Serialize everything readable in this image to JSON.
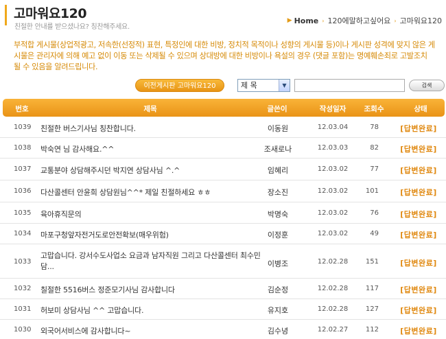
{
  "header": {
    "title": "고마워요120",
    "subtitle": "친절한 안내를 받으셨나요? 칭찬해주세요."
  },
  "breadcrumb": {
    "home": "Home",
    "items": [
      "120에말하고싶어요",
      "고마워요120"
    ]
  },
  "notice": "부적합 게시물(상업적광고, 저속한(선정적) 표현, 특정인에 대한 비방, 정치적 목적이나 성향의 게시물 등)이나 게시판 성격에 맞지 않은 게시물은 관리자에 의해 예고 없이 이동 또는 삭제될 수 있으며 상대방에 대한 비방이나 욕설의 경우 (댓글 포함)는 명예훼손죄로 고발조치 될 수 있음을 알려드립니다.",
  "search": {
    "prev_board_label": "이전게시판 고마워요120",
    "select_value": "제 목",
    "input_value": "",
    "button_label": "검색"
  },
  "table": {
    "columns": [
      "번호",
      "제목",
      "글쓴이",
      "작성일자",
      "조회수",
      "상태"
    ],
    "rows": [
      {
        "num": "1039",
        "title": "친절한 버스기사님 칭찬합니다.",
        "author": "이동원",
        "date": "12.03.04",
        "views": "78",
        "status": "[답변완료]"
      },
      {
        "num": "1038",
        "title": "박숙연 님 감사해요.^^",
        "author": "조새로나",
        "date": "12.03.03",
        "views": "82",
        "status": "[답변완료]"
      },
      {
        "num": "1037",
        "title": "교통분야 상담해주시던 박지연 상담사님 ^.^",
        "author": "임혜리",
        "date": "12.03.02",
        "views": "77",
        "status": "[답변완료]"
      },
      {
        "num": "1036",
        "title": "다산콜센터 안윤희 상담원님^^* 제일 친절하세요 ㅎㅎ",
        "author": "장소진",
        "date": "12.03.02",
        "views": "101",
        "status": "[답변완료]"
      },
      {
        "num": "1035",
        "title": "육아휴직문의",
        "author": "박명숙",
        "date": "12.03.02",
        "views": "76",
        "status": "[답변완료]"
      },
      {
        "num": "1034",
        "title": "마포구청앞자전거도로안전확보(매우위험)",
        "author": "이정훈",
        "date": "12.03.02",
        "views": "49",
        "status": "[답변완료]"
      },
      {
        "num": "1033",
        "title": "고맙습니다. 강서수도사업소 요금과 남자직원 그리고 다산콜센터 최수민 담...",
        "author": "이병조",
        "date": "12.02.28",
        "views": "151",
        "status": "[답변완료]"
      },
      {
        "num": "1032",
        "title": "칠절한 5516버스 정준모기사님 감사합니다",
        "author": "김순정",
        "date": "12.02.28",
        "views": "117",
        "status": "[답변완료]"
      },
      {
        "num": "1031",
        "title": "허보미 상담사님 ^^ 고맙습니다.",
        "author": "유지호",
        "date": "12.02.28",
        "views": "127",
        "status": "[답변완료]"
      },
      {
        "num": "1030",
        "title": "외국어서비스에 감사합니다~",
        "author": "김수녕",
        "date": "12.02.27",
        "views": "112",
        "status": "[답변완료]"
      }
    ]
  },
  "colors": {
    "accent": "#f0a81a",
    "notice_text": "#d68a07",
    "status_text": "#e0880f"
  }
}
